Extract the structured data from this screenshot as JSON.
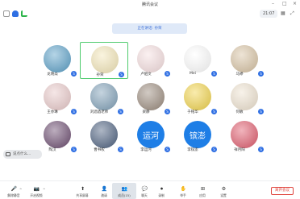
{
  "window": {
    "title": "腾讯会议",
    "timer": "21:07"
  },
  "banner": {
    "text": "正在讲话: 孙荣"
  },
  "participants": [
    {
      "name": "龙晓焱",
      "avatar": "nature-photo",
      "badge": "S",
      "color": "#5aa0c8"
    },
    {
      "name": "孙荣",
      "avatar": "flower-illustration",
      "badge": "S",
      "color": "#f4e7b8",
      "selected": true
    },
    {
      "name": "卢姐文",
      "avatar": "cartoon-character",
      "badge": "S",
      "color": "#f6dfe0"
    },
    {
      "name": "Mei",
      "avatar": "wristwatch",
      "badge": "S",
      "color": "#ffffff"
    },
    {
      "name": "马婷",
      "avatar": "dog-photo",
      "badge": "S",
      "color": "#d8c3a3"
    },
    {
      "name": "王亦琳",
      "avatar": "woman-photo",
      "badge": "S",
      "color": "#e9c9c9"
    },
    {
      "name": "刘酒酒老师",
      "avatar": "landscape-photo",
      "badge": "S",
      "color": "#7fa0b8"
    },
    {
      "name": "梁静",
      "avatar": "portrait-photo",
      "badge": "S",
      "color": "#9a8a7c"
    },
    {
      "name": "于铭华",
      "avatar": "sunflower",
      "badge": "S",
      "color": "#f2d44a"
    },
    {
      "name": "何敏",
      "avatar": "cartoon-girl",
      "badge": "S",
      "color": "#efe3d0"
    },
    {
      "name": "陶汉",
      "avatar": "sunset-photo",
      "badge": "S",
      "color": "#6a4a6e"
    },
    {
      "name": "曹书权",
      "avatar": "sky-photo",
      "badge": "S",
      "color": "#4b5f7e"
    },
    {
      "name": "李运河",
      "avatar": "text-avatar",
      "text": "运河",
      "badge": "S",
      "color": "#1e7ee6"
    },
    {
      "name": "李镔澎",
      "avatar": "text-avatar",
      "text": "镔澎",
      "badge": "S",
      "color": "#1e7ee6"
    },
    {
      "name": "祥月阳",
      "avatar": "colorful-art",
      "badge": "S",
      "color": "#e05a6c"
    }
  ],
  "chat_float": {
    "label": "说点什么..."
  },
  "toolbar": {
    "items": [
      {
        "label": "解除静音",
        "icon": "microphone-muted-icon"
      },
      {
        "label": "开启视频",
        "icon": "camera-off-icon"
      },
      {
        "label": "共享屏幕",
        "icon": "share-screen-icon"
      },
      {
        "label": "邀请",
        "icon": "invite-icon"
      },
      {
        "label": "成员(15)",
        "icon": "members-icon",
        "active": true
      },
      {
        "label": "聊天",
        "icon": "chat-icon"
      },
      {
        "label": "录制",
        "icon": "record-icon"
      },
      {
        "label": "举手",
        "icon": "raise-hand-icon"
      },
      {
        "label": "应用",
        "icon": "apps-icon"
      },
      {
        "label": "设置",
        "icon": "settings-icon"
      }
    ],
    "leave_label": "离开会议"
  },
  "colors": {
    "accent": "#2f6fe3",
    "selected_border": "#4fcb6d",
    "leave": "#e0463f"
  }
}
